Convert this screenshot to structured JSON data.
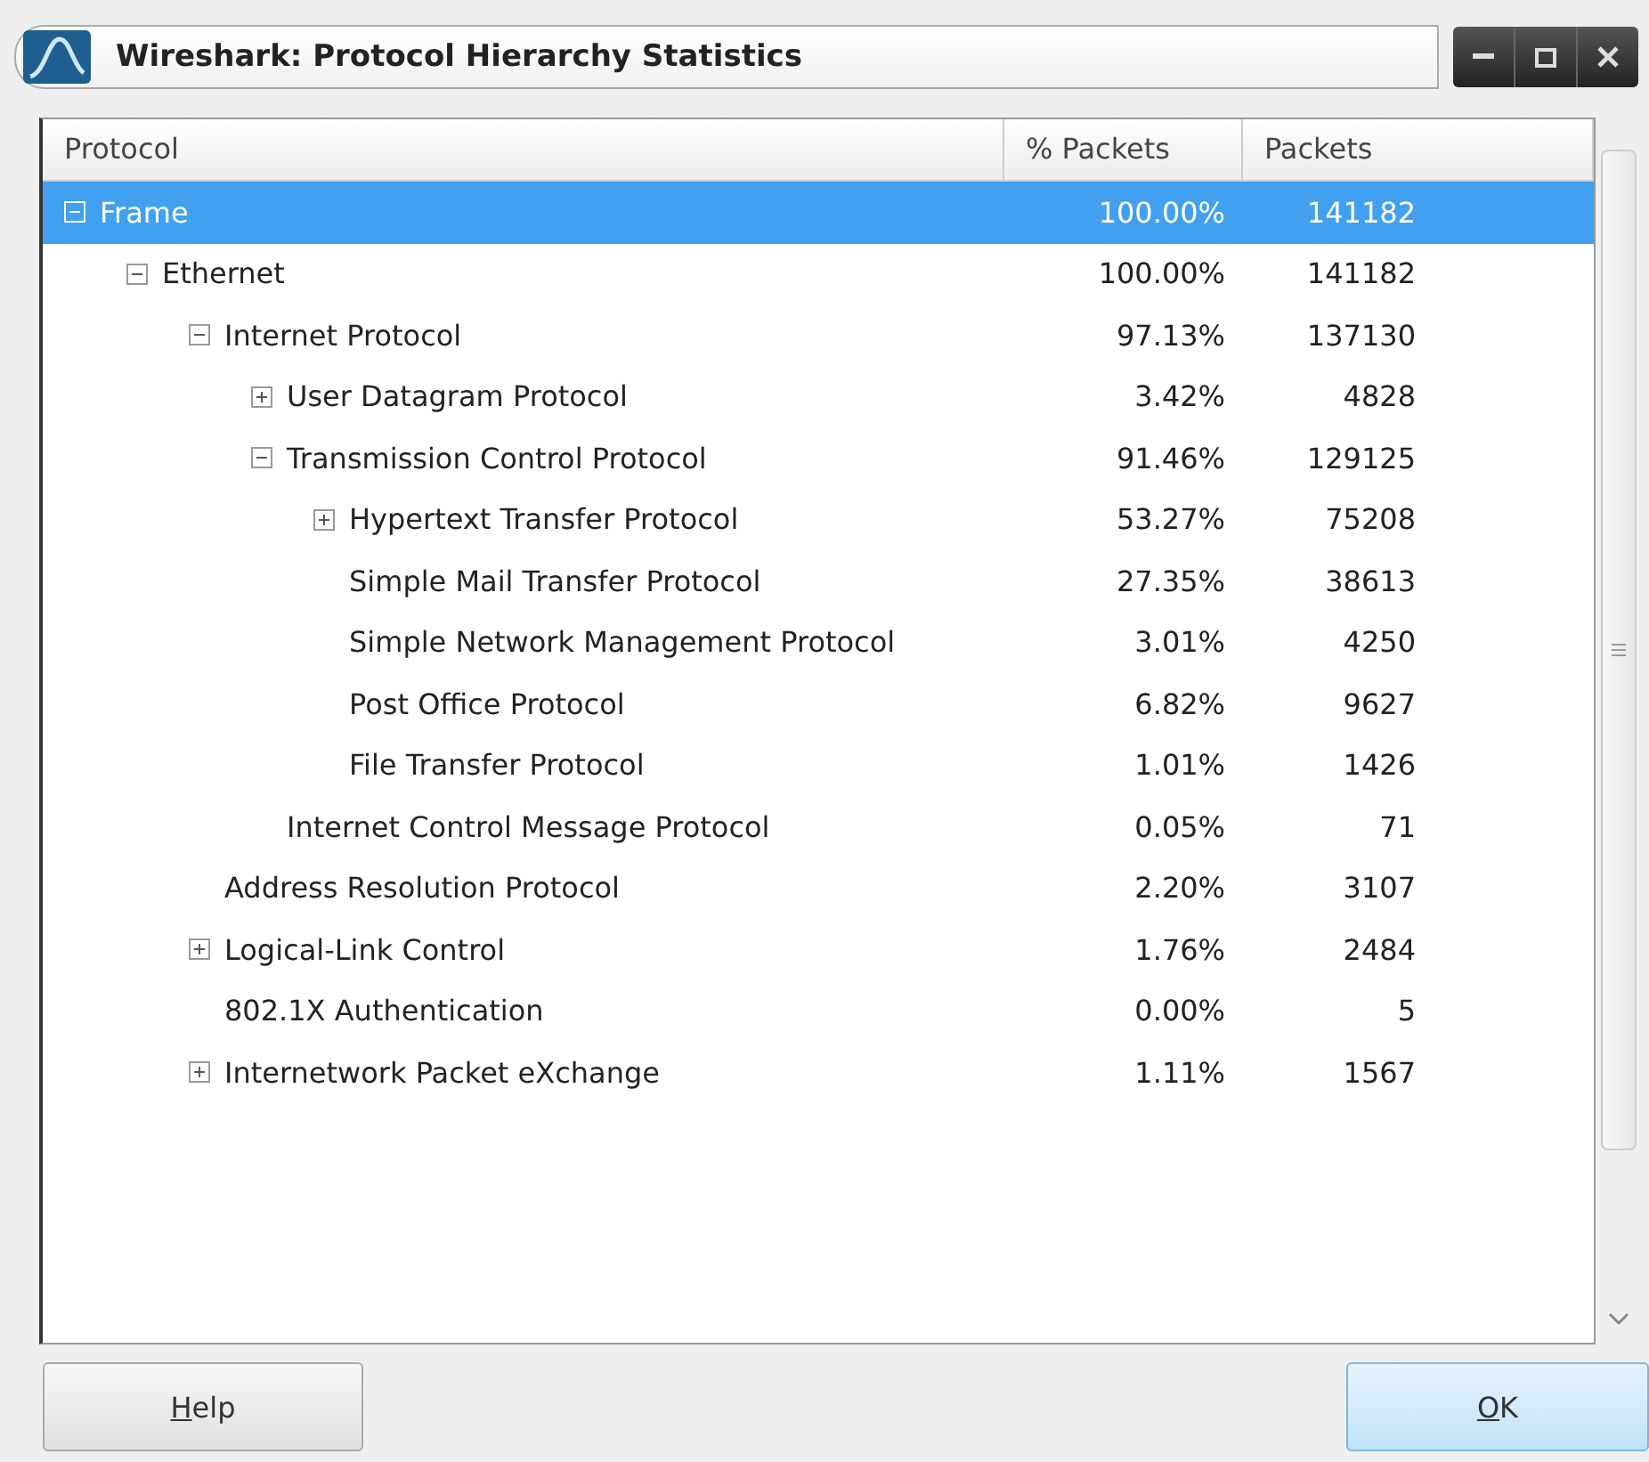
{
  "window": {
    "title": "Wireshark: Protocol Hierarchy Statistics"
  },
  "table": {
    "columns": [
      "Protocol",
      "% Packets",
      "Packets"
    ],
    "rows": [
      {
        "protocol": "Frame",
        "percent": "100.00%",
        "packets": "141182",
        "selected": true,
        "expanded": true,
        "children": [
          {
            "protocol": "Ethernet",
            "percent": "100.00%",
            "packets": "141182",
            "selected": false,
            "expanded": true,
            "children": [
              {
                "protocol": "Internet Protocol",
                "percent": "97.13%",
                "packets": "137130",
                "selected": false,
                "expanded": true,
                "children": [
                  {
                    "protocol": "User Datagram Protocol",
                    "percent": "3.42%",
                    "packets": "4828",
                    "selected": false,
                    "expanded": false
                  },
                  {
                    "protocol": "Transmission Control Protocol",
                    "percent": "91.46%",
                    "packets": "129125",
                    "selected": false,
                    "expanded": true,
                    "children": [
                      {
                        "protocol": "Hypertext Transfer Protocol",
                        "percent": "53.27%",
                        "packets": "75208",
                        "selected": false,
                        "expanded": false
                      },
                      {
                        "protocol": "Simple Mail Transfer Protocol",
                        "percent": "27.35%",
                        "packets": "38613",
                        "selected": false
                      },
                      {
                        "protocol": "Simple Network Management Protocol",
                        "percent": "3.01%",
                        "packets": "4250",
                        "selected": false
                      },
                      {
                        "protocol": "Post Office Protocol",
                        "percent": "6.82%",
                        "packets": "9627",
                        "selected": false
                      },
                      {
                        "protocol": "File Transfer Protocol",
                        "percent": "1.01%",
                        "packets": "1426",
                        "selected": false
                      }
                    ]
                  },
                  {
                    "protocol": "Internet Control Message Protocol",
                    "percent": "0.05%",
                    "packets": "71",
                    "selected": false
                  }
                ]
              },
              {
                "protocol": "Address Resolution Protocol",
                "percent": "2.20%",
                "packets": "3107",
                "selected": false
              },
              {
                "protocol": "Logical-Link Control",
                "percent": "1.76%",
                "packets": "2484",
                "selected": false,
                "expanded": false
              },
              {
                "protocol": "802.1X Authentication",
                "percent": "0.00%",
                "packets": "5",
                "selected": false
              },
              {
                "protocol": "Internetwork Packet eXchange",
                "percent": "1.11%",
                "packets": "1567",
                "selected": false,
                "expanded": false
              }
            ]
          }
        ]
      }
    ]
  },
  "buttons": [
    {
      "mnemonic": "H",
      "rest": "elp",
      "kind": "plain"
    },
    {
      "mnemonic": "O",
      "rest": "K",
      "kind": "default"
    }
  ]
}
